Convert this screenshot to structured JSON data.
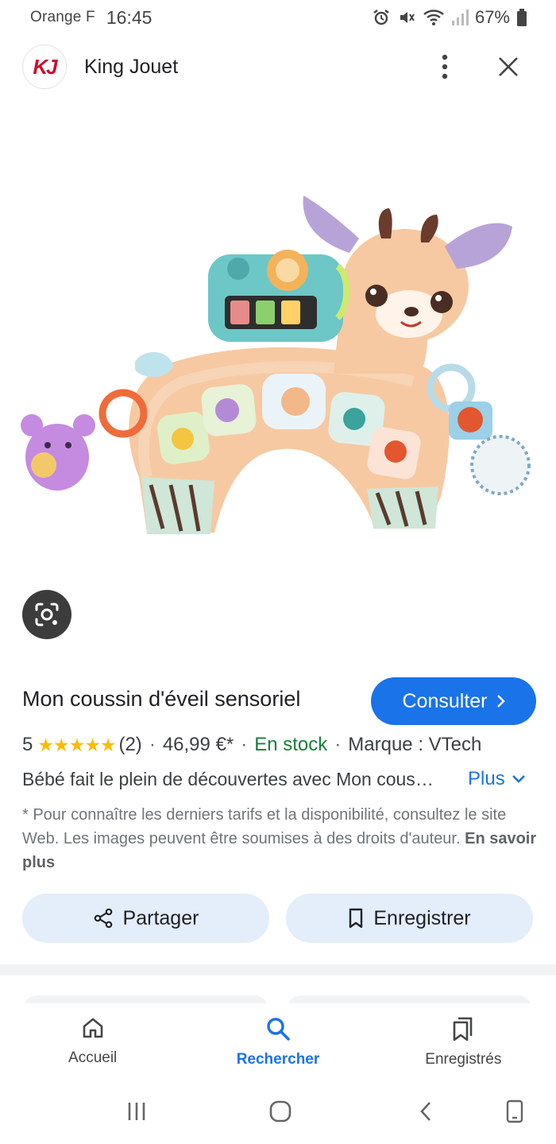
{
  "status_bar": {
    "carrier": "Orange F",
    "time": "16:45",
    "battery": "67%"
  },
  "header": {
    "logo_text": "KJ",
    "site_name": "King Jouet"
  },
  "product": {
    "title": "Mon coussin d'éveil sensoriel",
    "consult_label": "Consulter",
    "rating": "5",
    "stars": "★★★★★",
    "reviews": "(2)",
    "price": "46,99 €*",
    "availability": "En stock",
    "brand": "Marque : VTech",
    "description": "Bébé fait le plein de découvertes avec Mon coussin d'éveil sensoriel",
    "more_label": "Plus",
    "disclaimer": "* Pour connaître les derniers tarifs et la disponibilité, consultez le site Web. Les images peuvent être soumises à des droits d'auteur.",
    "learn_more": "En savoir plus"
  },
  "actions": {
    "share": "Partager",
    "save": "Enregistrer"
  },
  "bottom_nav": {
    "items": [
      {
        "label": "Accueil",
        "icon": "home-icon"
      },
      {
        "label": "Rechercher",
        "icon": "search-icon"
      },
      {
        "label": "Enregistrés",
        "icon": "saved-icon"
      }
    ],
    "active": "Rechercher"
  },
  "colors": {
    "accent": "#1a73e8",
    "in_stock": "#188038",
    "stars": "#fbbc04",
    "brand_red": "#c8102e"
  }
}
